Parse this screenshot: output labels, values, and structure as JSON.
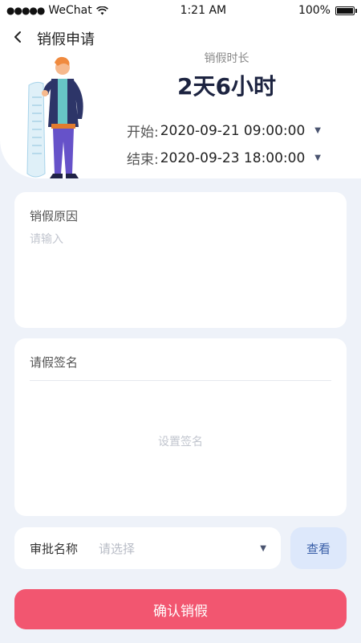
{
  "status_bar": {
    "signal": "●●●●●",
    "carrier": "WeChat",
    "wifi_icon": "wifi-icon",
    "time": "1:21 AM",
    "battery": "100%",
    "battery_level": 1.0
  },
  "nav": {
    "back_icon": "chevron-left-icon",
    "title": "销假申请"
  },
  "summary": {
    "duration_label": "销假时长",
    "duration_value": "2天6小时",
    "start_label": "开始:",
    "start_value": "2020-09-21 09:00:00",
    "end_label": "结束:",
    "end_value": "2020-09-23 18:00:00"
  },
  "reason": {
    "title": "销假原因",
    "placeholder": "请输入"
  },
  "signature": {
    "title": "请假签名",
    "set_label": "设置签名"
  },
  "approval": {
    "label": "审批名称",
    "placeholder": "请选择",
    "view_label": "查看"
  },
  "confirm": {
    "label": "确认销假"
  },
  "colors": {
    "accent": "#f25670",
    "view_bg": "#dde8fb",
    "background": "#eef2f9",
    "title": "#1c2340"
  }
}
